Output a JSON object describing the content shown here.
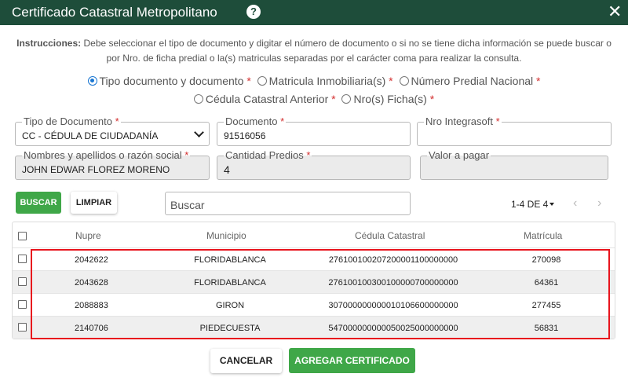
{
  "header": {
    "title": "Certificado Catastral Metropolitano",
    "help": "?",
    "close": "✕"
  },
  "instructions": {
    "label": "Instrucciones:",
    "text": " Debe seleccionar el tipo de documento y digitar el número de documento o si no se tiene dicha información se puede buscar o por Nro. de ficha predial o la(s) matriculas separadas por el carácter coma para realizar la consulta."
  },
  "search_options": [
    {
      "label": "Tipo documento y documento",
      "required": "*",
      "selected": true
    },
    {
      "label": "Matricula Inmobiliaria(s)",
      "required": "*",
      "selected": false
    },
    {
      "label": "Número Predial Nacional",
      "required": "*",
      "selected": false
    },
    {
      "label": "Cédula Catastral Anterior",
      "required": "*",
      "selected": false
    },
    {
      "label": "Nro(s) Ficha(s)",
      "required": "*",
      "selected": false
    }
  ],
  "form": {
    "tipo_documento": {
      "label": "Tipo de Documento",
      "required": "*",
      "value": "CC - CÉDULA DE CIUDADANÍA"
    },
    "documento": {
      "label": "Documento",
      "required": "*",
      "value": "91516056"
    },
    "nro_integrasoft": {
      "label": "Nro Integrasoft",
      "required": "*",
      "value": ""
    },
    "nombres": {
      "label": "Nombres y apellidos o razón social",
      "required": "*",
      "value": "JOHN EDWAR FLOREZ MORENO"
    },
    "cantidad_predios": {
      "label": "Cantidad Predios",
      "required": "*",
      "value": "4"
    },
    "valor_pagar": {
      "label": "Valor a pagar",
      "value": ""
    }
  },
  "toolbar": {
    "buscar": "BUSCAR",
    "limpiar": "LIMPIAR",
    "search_placeholder": "Buscar",
    "pager": "1-4 DE 4",
    "prev": "‹",
    "next": "›"
  },
  "table": {
    "headers": [
      "Nupre",
      "Municipio",
      "Cédula Catastral",
      "Matrícula"
    ],
    "rows": [
      [
        "2042622",
        "FLORIDABLANCA",
        "276100100207200001100000000",
        "270098"
      ],
      [
        "2043628",
        "FLORIDABLANCA",
        "276100100300100000700000000",
        "64361"
      ],
      [
        "2088883",
        "GIRON",
        "307000000000010106600000000",
        "277455"
      ],
      [
        "2140706",
        "PIEDECUESTA",
        "547000000000050025000000000",
        "56831"
      ]
    ]
  },
  "footer": {
    "cancelar": "CANCELAR",
    "agregar": "AGREGAR CERTIFICADO"
  },
  "colors": {
    "header": "#1e4d3a",
    "accent_green": "#3fa748",
    "required": "#d32f2f",
    "radio_selected": "#1976d2",
    "highlight": "#e8141d"
  }
}
